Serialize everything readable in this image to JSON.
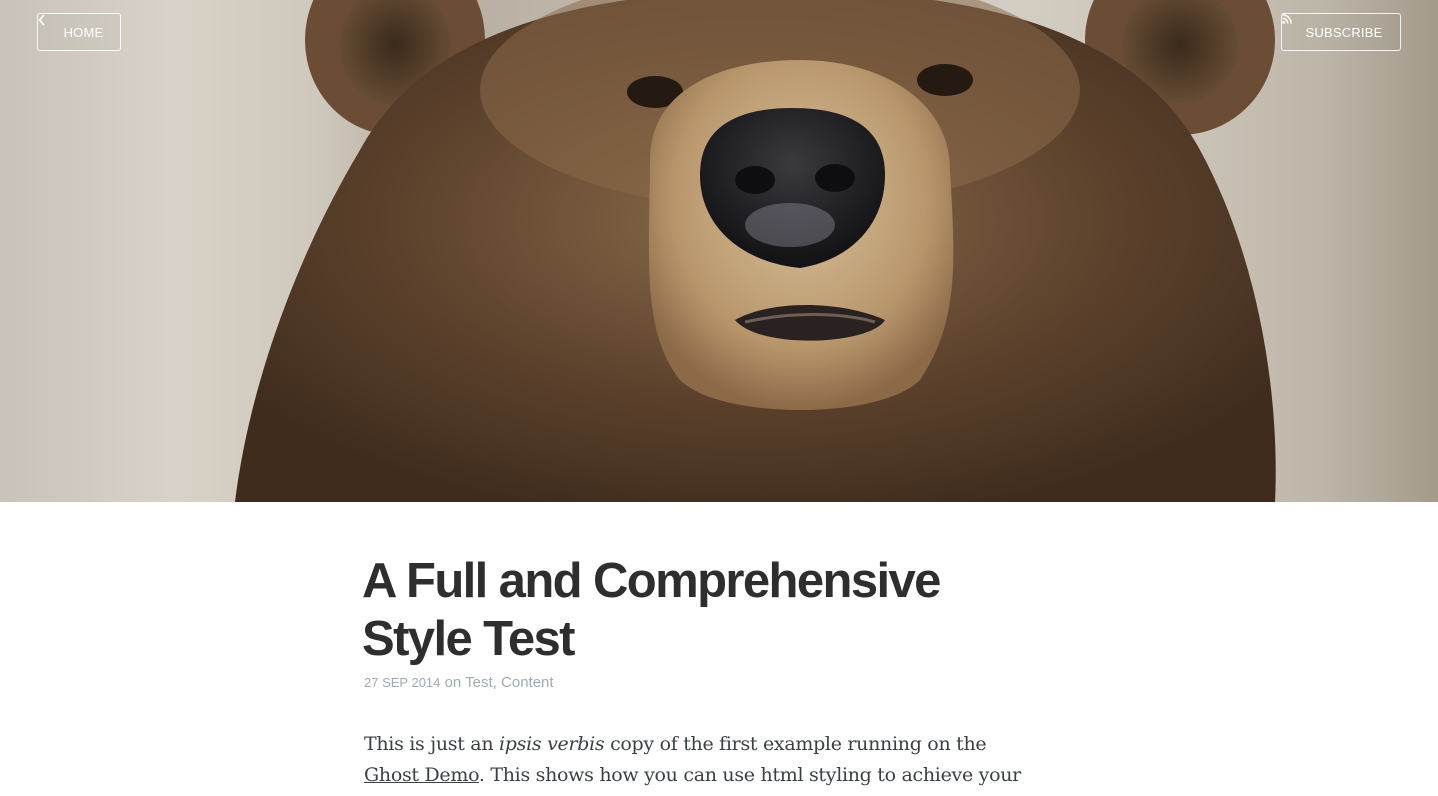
{
  "nav": {
    "home_label": "HOME",
    "subscribe_label": "SUBSCRIBE",
    "home_icon": "chevron-left-icon",
    "subscribe_icon": "rss-icon"
  },
  "hero": {
    "image": "bear-portrait-photo",
    "colors": {
      "fur_dark": "#4a3423",
      "fur_mid": "#7a5a3e",
      "muzzle": "#c9ae86",
      "nose": "#1e1d20",
      "background": "#d2ccc1"
    }
  },
  "post": {
    "title_line1": "A Full and Comprehensive",
    "title_line2": "Style Test",
    "date": "27 SEP 2014",
    "on_text": "on",
    "tags": [
      "Test",
      "Content"
    ],
    "tag_separator": ",",
    "body": {
      "part1": "This is just an ",
      "emphasis": "ipsis verbis",
      "part2": " copy of the first example running on the ",
      "link_text": "Ghost Demo",
      "part3": ". This shows how you can use html styling to achieve your hopes."
    }
  },
  "colors": {
    "title": "#2e2e2e",
    "meta": "#9eabb3",
    "body_text": "#3a4145",
    "nav_border": "#ffffff"
  }
}
